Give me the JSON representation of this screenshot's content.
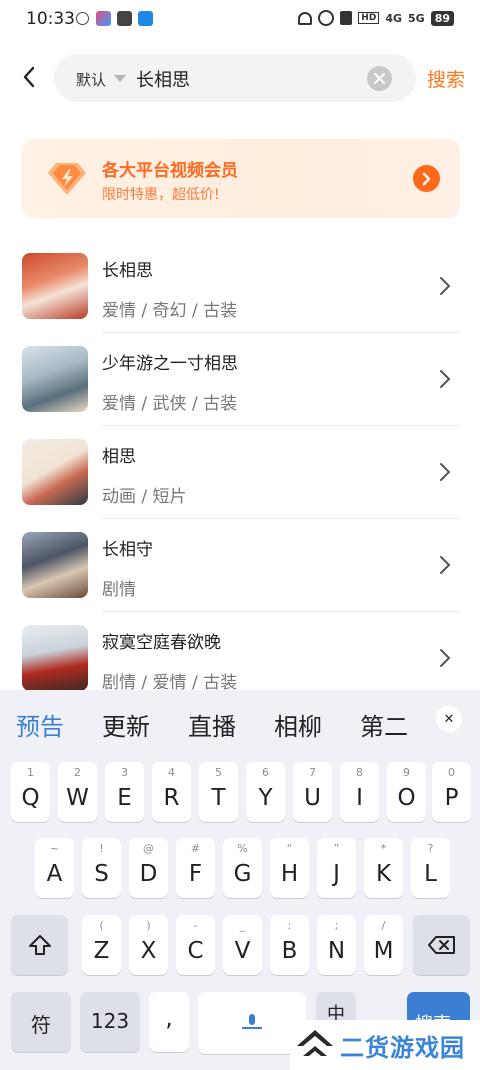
{
  "status_bar": {
    "time": "10:33",
    "battery": "89",
    "network_1": "4G",
    "network_2": "5G",
    "hd": "HD"
  },
  "search": {
    "sort_label": "默认",
    "query": "长相思",
    "button_label": "搜索"
  },
  "banner": {
    "title": "各大平台视频会员",
    "subtitle": "限时特惠，超低价!"
  },
  "results": [
    {
      "title": "长相思",
      "tags": "爱情 / 奇幻 / 古装"
    },
    {
      "title": "少年游之一寸相思",
      "tags": "爱情 / 武侠 / 古装"
    },
    {
      "title": "相思",
      "tags": "动画 / 短片"
    },
    {
      "title": "长相守",
      "tags": "剧情"
    },
    {
      "title": "寂寞空庭春欲晚",
      "tags": "剧情 / 爱情 / 古装"
    }
  ],
  "keyboard": {
    "candidates": [
      "预告",
      "更新",
      "直播",
      "相柳",
      "第二"
    ],
    "row1": [
      {
        "k": "Q",
        "h": "1"
      },
      {
        "k": "W",
        "h": "2"
      },
      {
        "k": "E",
        "h": "3"
      },
      {
        "k": "R",
        "h": "4"
      },
      {
        "k": "T",
        "h": "5"
      },
      {
        "k": "Y",
        "h": "6"
      },
      {
        "k": "U",
        "h": "7"
      },
      {
        "k": "I",
        "h": "8"
      },
      {
        "k": "O",
        "h": "9"
      },
      {
        "k": "P",
        "h": "0"
      }
    ],
    "row2": [
      {
        "k": "A",
        "h": "~"
      },
      {
        "k": "S",
        "h": "!"
      },
      {
        "k": "D",
        "h": "@"
      },
      {
        "k": "F",
        "h": "#"
      },
      {
        "k": "G",
        "h": "%"
      },
      {
        "k": "H",
        "h": "“"
      },
      {
        "k": "J",
        "h": "”"
      },
      {
        "k": "K",
        "h": "*"
      },
      {
        "k": "L",
        "h": "?"
      }
    ],
    "row3": [
      {
        "k": "Z",
        "h": "("
      },
      {
        "k": "X",
        "h": ")"
      },
      {
        "k": "C",
        "h": "-"
      },
      {
        "k": "V",
        "h": "_"
      },
      {
        "k": "B",
        "h": ":"
      },
      {
        "k": "N",
        "h": ";"
      },
      {
        "k": "M",
        "h": "/"
      }
    ],
    "symbol_key": "符",
    "number_key": "123",
    "comma_key": ",",
    "lang_key": "中",
    "go_key": "搜索"
  },
  "watermark": {
    "text": "二货游戏园"
  }
}
